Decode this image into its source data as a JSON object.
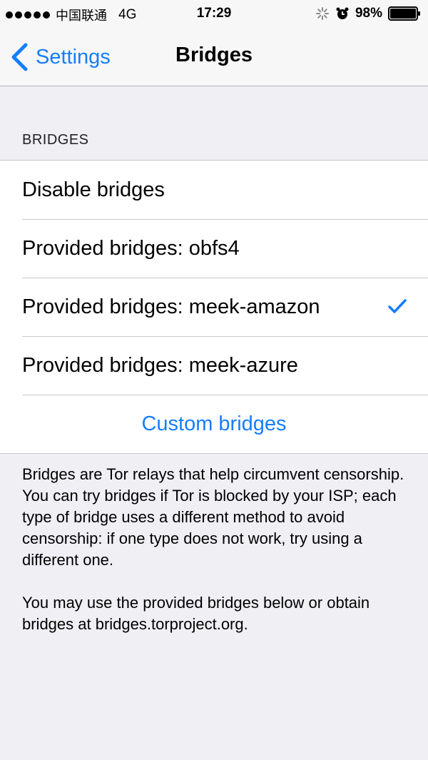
{
  "status_bar": {
    "carrier": "中国联通",
    "network": "4G",
    "time": "17:29",
    "battery": "98%"
  },
  "nav": {
    "back_label": "Settings",
    "title": "Bridges"
  },
  "section": {
    "header": "BRIDGES",
    "rows": [
      {
        "label": "Disable bridges",
        "selected": false
      },
      {
        "label": "Provided bridges: obfs4",
        "selected": false
      },
      {
        "label": "Provided bridges: meek-amazon",
        "selected": true
      },
      {
        "label": "Provided bridges: meek-azure",
        "selected": false
      }
    ],
    "custom_label": "Custom bridges"
  },
  "footer": {
    "paragraph1": "Bridges are Tor relays that help circumvent censorship. You can try bridges if Tor is blocked by your ISP; each type of bridge uses a different method to avoid censorship: if one type does not work, try using a different one.",
    "paragraph2": "You may use the provided bridges below or obtain bridges at bridges.torproject.org."
  },
  "colors": {
    "accent": "#157efb",
    "background": "#efeff4",
    "separator": "#c8c7cc"
  }
}
